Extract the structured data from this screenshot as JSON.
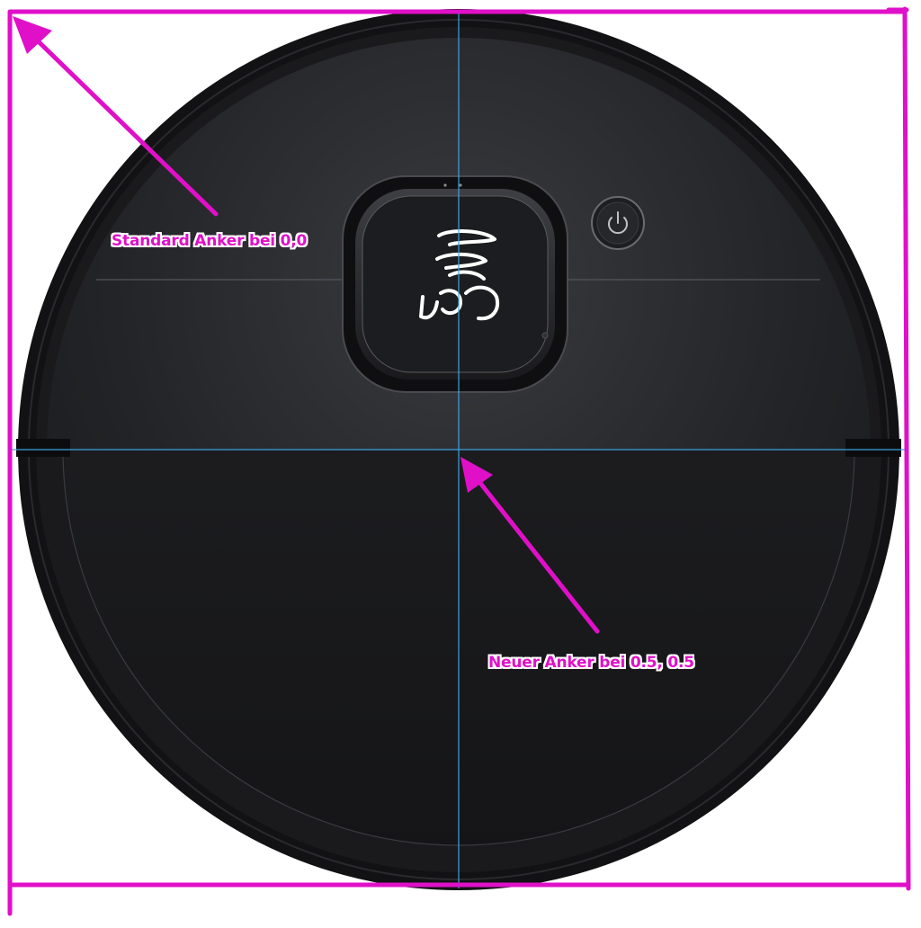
{
  "annotations": {
    "default_anchor": "Standard Anker bei 0,0",
    "new_anchor": "Neuer Anker bei 0.5, 0.5"
  },
  "colors": {
    "annotation": "#e010c8",
    "guide_lines": "#3aa3e0",
    "robot_body": "#1f1f22",
    "bumper": "#141416",
    "background": "#ffffff"
  },
  "icons": [
    "power-icon",
    "robot-logo-icon"
  ]
}
